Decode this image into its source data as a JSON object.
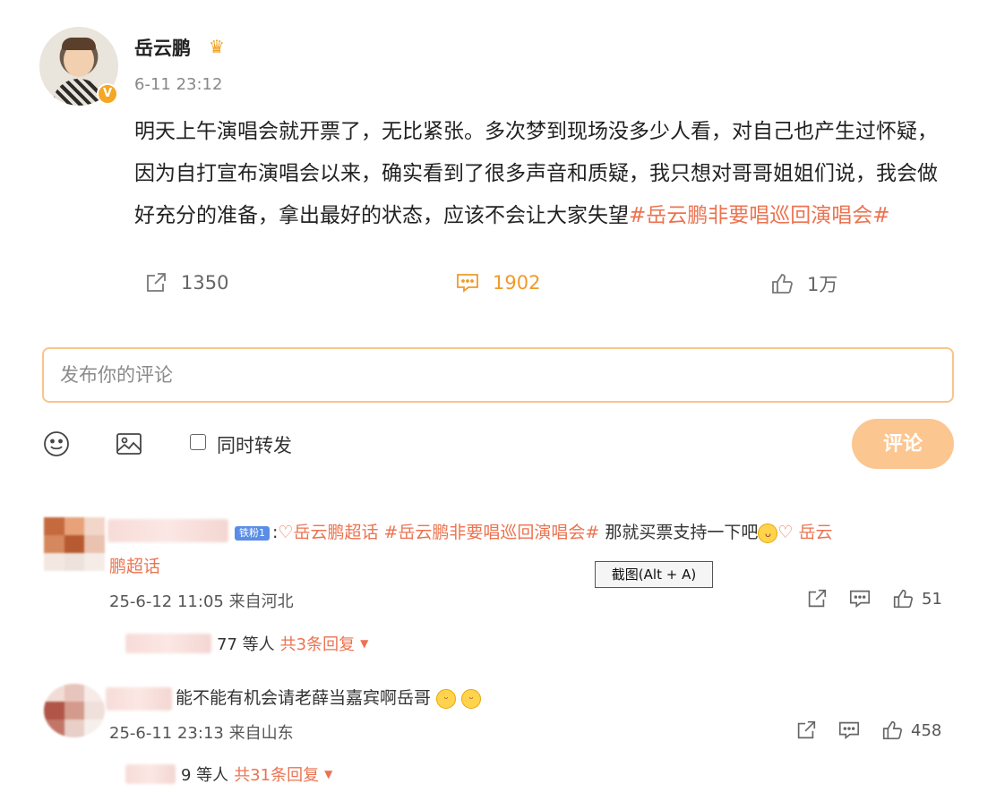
{
  "post": {
    "author": "岳云鹏",
    "time": "6-11 23:12",
    "text_main": "明天上午演唱会就开票了，无比紧张。多次梦到现场没多少人看，对自己也产生过怀疑，因为自打宣布演唱会以来，确实看到了很多声音和质疑，我只想对哥哥姐姐们说，我会做好充分的准备，拿出最好的状态，应该不会让大家失望",
    "text_tag": "#岳云鹏非要唱巡回演唱会#",
    "repost_count": "1350",
    "comment_count": "1902",
    "like_count": "1万"
  },
  "composer": {
    "placeholder": "发布你的评论",
    "repost_label": "同时转发",
    "submit_label": "评论"
  },
  "tooltip": "截图(Alt + A)",
  "comments": [
    {
      "badge": "铁粉1",
      "tag1": "岳云鹏超话",
      "tag2": "#岳云鹏非要唱巡回演唱会#",
      "text": "那就买票支持一下吧",
      "tag3_line1": "岳云",
      "tag3_line2": "鹏超话",
      "meta": "25-6-12 11:05 来自河北",
      "likes": "51",
      "reply_names": "77 等人",
      "reply_count": "共3条回复"
    },
    {
      "text": "能不能有机会请老薛当嘉宾啊岳哥",
      "meta": "25-6-11 23:13 来自山东",
      "likes": "458",
      "reply_names": "9 等人",
      "reply_count": "共31条回复"
    }
  ],
  "colors": {
    "accent_orange": "#eb7350",
    "comment_orange": "#f09a2a",
    "button_bg": "#fbc690",
    "input_border": "#f7c58a"
  }
}
